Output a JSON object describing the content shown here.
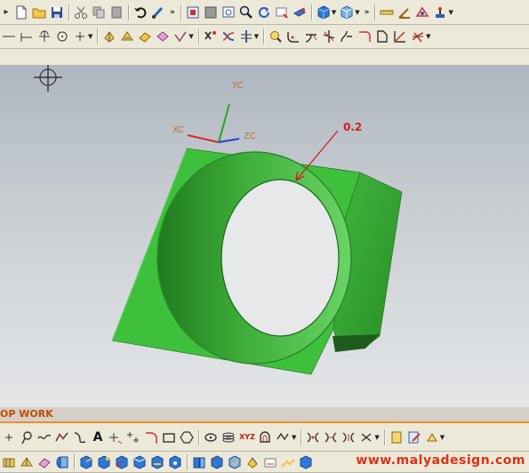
{
  "toolbar_top": {
    "icons_group1": [
      "layer-menu-icon",
      "new-file-icon",
      "open-folder-icon",
      "save-icon"
    ],
    "icons_group2": [
      "cut-icon",
      "copy-icon",
      "paste-icon"
    ],
    "icons_group3": [
      "undo-icon",
      "brush-icon"
    ],
    "icons_group4": [
      "fit-view-icon",
      "shade-square-icon",
      "zoom-window-icon",
      "zoom-icon",
      "rotate-icon",
      "pan-icon",
      "perspective-icon"
    ],
    "icons_group5": [
      "blue-cube-icon",
      "light-cube-icon"
    ],
    "icons_group6": [
      "ruler-icon",
      "measure-angle-icon",
      "analysis-icon",
      "joystick-icon"
    ]
  },
  "toolbar_second": {
    "icons_group1": [
      "line-icon",
      "tee-icon",
      "cross-icon",
      "circle-icon",
      "point-icon"
    ],
    "icons_group2": [
      "extrude-icon",
      "revolve-icon",
      "sweep-icon",
      "trim-icon",
      "sew-icon"
    ],
    "icons_group3": [
      "xform-icon",
      "quick-trim-icon",
      "mirror-icon"
    ],
    "icons_group4": [
      "find-icon",
      "fillet-icon",
      "trim-curve-icon",
      "intersect-icon",
      "curve-icon",
      "corner-icon",
      "rect-sketch-icon",
      "chamfer-icon",
      "extend-icon"
    ]
  },
  "viewport": {
    "axis_labels": {
      "yc": "YC",
      "xc": "XC",
      "zc": "ZC"
    },
    "annotation_value": "0.2",
    "colors": {
      "part_green": "#3fc03c",
      "part_dark": "#1e7a1e",
      "annotation": "#d21e1e"
    }
  },
  "status": {
    "text": "OP WORK"
  },
  "toolbar_bottom1": {
    "text_tool_label": "A",
    "icons": [
      "point-icon",
      "lasso-icon",
      "spline-icon",
      "polyline-icon",
      "arc-icon",
      "text-tool-icon",
      "plus-point-icon",
      "plus-multi-icon",
      "fillet-sketch-icon",
      "rectangle-icon",
      "hexagon-icon",
      "ellipse-icon",
      "helix-icon",
      "xyz-icon",
      "offset-icon",
      "project-icon",
      "constraint1-icon",
      "constraint2-icon",
      "constraint3-icon",
      "constraint4-icon",
      "folder-icon",
      "edit-icon",
      "paint-icon"
    ]
  },
  "toolbar_bottom2": {
    "icons": [
      "feature1-icon",
      "feature2-icon",
      "feature3-icon",
      "feature4-icon",
      "solid1-icon",
      "solid2-icon",
      "solid3-icon",
      "solid4-icon",
      "solid5-icon",
      "solid6-icon",
      "solid7-icon",
      "solid8-icon",
      "solid9-icon",
      "solid10-icon",
      "solid11-icon",
      "solid12-icon",
      "solid13-icon"
    ]
  },
  "watermark": "www.malyadesign.com"
}
